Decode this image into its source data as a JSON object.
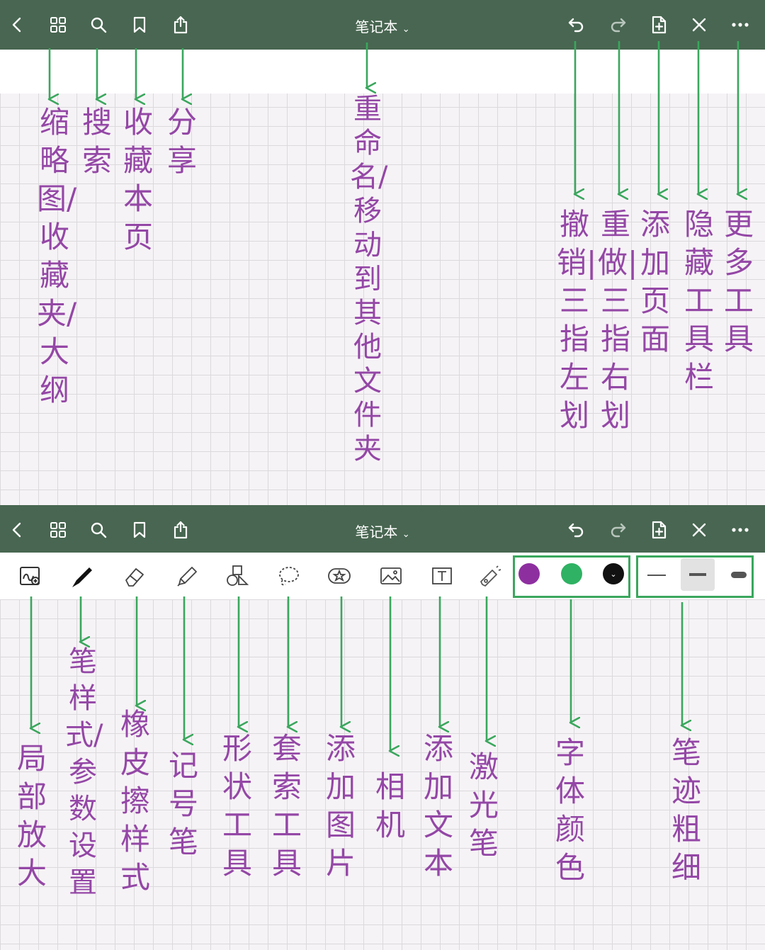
{
  "toolbar": {
    "title": "笔记本",
    "buttons": [
      "back-icon",
      "thumbnails-icon",
      "search-icon",
      "bookmark-icon",
      "share-icon",
      "undo-icon",
      "redo-icon",
      "add-page-icon",
      "close-icon",
      "more-icon"
    ]
  },
  "annotations_top": [
    {
      "id": "thumbnails",
      "text": "缩略图/收藏夹/大纲"
    },
    {
      "id": "search",
      "text": "搜索"
    },
    {
      "id": "bookmark",
      "text": "收藏本页"
    },
    {
      "id": "share",
      "text": "分享"
    },
    {
      "id": "title",
      "text": "重命名/移动到其他文件夹"
    },
    {
      "id": "undo",
      "text": "撤销|三指左划"
    },
    {
      "id": "redo",
      "text": "重做|三指右划"
    },
    {
      "id": "add-page",
      "text": "添加页面"
    },
    {
      "id": "hide-toolbar",
      "text": "隐藏工具栏"
    },
    {
      "id": "more",
      "text": "更多工具"
    }
  ],
  "annotations_bottom": [
    {
      "id": "zoom",
      "text": "局部放大"
    },
    {
      "id": "pen",
      "text": "笔样式/参数设置"
    },
    {
      "id": "eraser",
      "text": "橡皮擦样式"
    },
    {
      "id": "marker",
      "text": "记号笔"
    },
    {
      "id": "shape",
      "text": "形状工具"
    },
    {
      "id": "lasso",
      "text": "套索工具"
    },
    {
      "id": "image",
      "text": "添加图片"
    },
    {
      "id": "camera",
      "text": "相机"
    },
    {
      "id": "text",
      "text": "添加文本"
    },
    {
      "id": "laser",
      "text": "激光笔"
    },
    {
      "id": "color",
      "text": "字体颜色"
    },
    {
      "id": "width",
      "text": "笔迹粗细"
    }
  ],
  "drawing_tools": [
    "zoom-icon",
    "pen-icon",
    "eraser-icon",
    "highlighter-icon",
    "shapes-icon",
    "lasso-icon",
    "sticker-icon",
    "image-icon",
    "text-box-icon",
    "laser-pointer-icon"
  ],
  "colors": {
    "toolbar": "#486651",
    "arrow": "#3aa75d",
    "annotation": "#9447a6",
    "swatch_purple": "#8e2fa0",
    "swatch_green": "#2fb263",
    "swatch_black": "#111111"
  }
}
